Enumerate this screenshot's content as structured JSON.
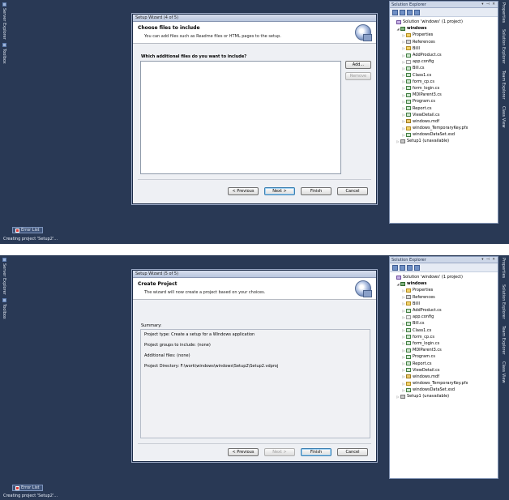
{
  "left_tabs": [
    "Server Explorer",
    "Toolbox"
  ],
  "right_tabs": [
    "Properties",
    "Solution Explorer",
    "Team Explorer",
    "Class View"
  ],
  "solution_explorer": {
    "title": "Solution Explorer",
    "controls": "▾ ⊣ ✕",
    "tree": [
      {
        "label": "Solution 'windows' (1 project)",
        "icon": "solution-icon",
        "level": 0
      },
      {
        "label": "windows",
        "icon": "project-icon",
        "level": 1,
        "bold": true
      },
      {
        "label": "Properties",
        "icon": "folder-icon",
        "level": 2
      },
      {
        "label": "References",
        "icon": "references-icon",
        "level": 2
      },
      {
        "label": "Billl",
        "icon": "folder-icon",
        "level": 2
      },
      {
        "label": "AddProduct.cs",
        "icon": "cs-file-icon",
        "level": 2
      },
      {
        "label": "app.config",
        "icon": "config-file-icon",
        "level": 2
      },
      {
        "label": "Bill.cs",
        "icon": "cs-file-icon",
        "level": 2
      },
      {
        "label": "Class1.cs",
        "icon": "cs-file-icon",
        "level": 2
      },
      {
        "label": "form_cp.cs",
        "icon": "cs-file-icon",
        "level": 2
      },
      {
        "label": "form_login.cs",
        "icon": "cs-file-icon",
        "level": 2
      },
      {
        "label": "MDIParent3.cs",
        "icon": "cs-file-icon",
        "level": 2
      },
      {
        "label": "Program.cs",
        "icon": "cs-file-icon",
        "level": 2
      },
      {
        "label": "Report.cs",
        "icon": "cs-file-icon",
        "level": 2
      },
      {
        "label": "ViewDetail.cs",
        "icon": "cs-file-icon",
        "level": 2
      },
      {
        "label": "windows.mdf",
        "icon": "database-icon",
        "level": 2
      },
      {
        "label": "windows_TemporaryKey.pfx",
        "icon": "key-file-icon",
        "level": 2
      },
      {
        "label": "windowsDataSet.xsd",
        "icon": "dataset-icon",
        "level": 2
      },
      {
        "label": "Setup1 (unavailable)",
        "icon": "setup-project-icon",
        "level": 1
      }
    ]
  },
  "error_list": "Error List",
  "status_text": "Creating project 'Setup2'...",
  "wizard1": {
    "title": "Setup Wizard (4 of 5)",
    "heading": "Choose files to include",
    "description": "You can add files such as Readme files or HTML pages to the setup.",
    "question": "Which additional files do you want to include?",
    "add_label": "Add...",
    "remove_label": "Remove",
    "previous_label": "< Previous",
    "next_label": "Next >",
    "finish_label": "Finish",
    "cancel_label": "Cancel"
  },
  "wizard2": {
    "title": "Setup Wizard (5 of 5)",
    "heading": "Create Project",
    "description": "The wizard will now create a project based on your choices.",
    "summary_label": "Summary:",
    "summary_lines": [
      "Project type: Create a setup for a Windows application",
      "Project groups to include: (none)",
      "Additional files: (none)",
      "Project Directory: F:\\work\\windows\\windows\\Setup2\\Setup2.vdproj"
    ],
    "previous_label": "< Previous",
    "next_label": "Next >",
    "finish_label": "Finish",
    "cancel_label": "Cancel"
  }
}
